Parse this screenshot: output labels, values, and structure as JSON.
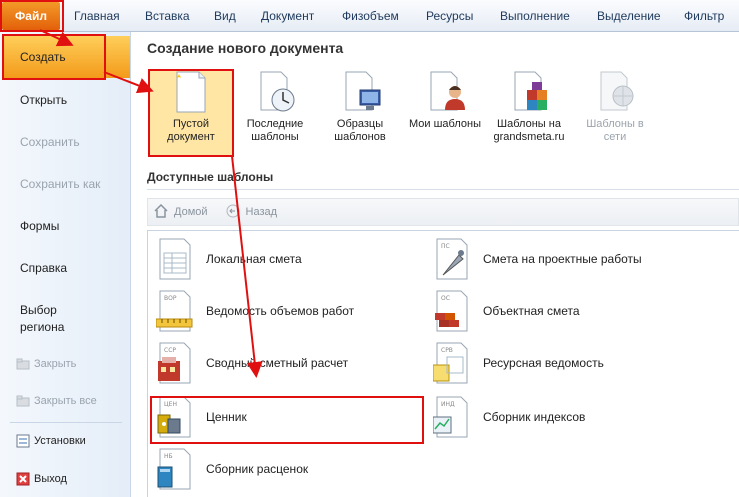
{
  "menubar": {
    "file": "Файл",
    "items": [
      "Главная",
      "Вставка",
      "Вид",
      "Документ",
      "Физобъем",
      "Ресурсы",
      "Выполнение",
      "Выделение",
      "Фильтр"
    ]
  },
  "leftpane": {
    "create": "Создать",
    "open": "Открыть",
    "save": "Сохранить",
    "save_as": "Сохранить как",
    "forms": "Формы",
    "help": "Справка",
    "region_line1": "Выбор",
    "region_line2": "региона",
    "close": "Закрыть",
    "close_all": "Закрыть все",
    "settings": "Установки",
    "exit": "Выход"
  },
  "main": {
    "title": "Создание нового документа",
    "templates": [
      {
        "line1": "Пустой",
        "line2": "документ",
        "icon": "blank-document-icon"
      },
      {
        "line1": "Последние",
        "line2": "шаблоны",
        "icon": "recent-templates-icon"
      },
      {
        "line1": "Образцы",
        "line2": "шаблонов",
        "icon": "sample-templates-icon"
      },
      {
        "line1": "Мои шаблоны",
        "line2": "",
        "icon": "my-templates-icon"
      },
      {
        "line1": "Шаблоны на",
        "line2": "grandsmeta.ru",
        "icon": "web-templates-icon"
      },
      {
        "line1": "Шаблоны в",
        "line2": "сети",
        "icon": "network-templates-icon"
      }
    ],
    "available_title": "Доступные шаблоны",
    "nav_home": "Домой",
    "nav_back": "Назад",
    "list": [
      {
        "label": "Локальная смета",
        "code": ""
      },
      {
        "label": "Смета на проектные работы",
        "code": "ПС"
      },
      {
        "label": "Ведомость объемов работ",
        "code": "ВОР"
      },
      {
        "label": "Объектная смета",
        "code": "ОС"
      },
      {
        "label": "Сводный сметный расчет",
        "code": "ССР"
      },
      {
        "label": "Ресурсная ведомость",
        "code": "СРВ"
      },
      {
        "label": "Ценник",
        "code": "ЦЕН"
      },
      {
        "label": "Сборник индексов",
        "code": "ИНД"
      },
      {
        "label": "Сборник расценок",
        "code": "НБ"
      }
    ]
  },
  "colors": {
    "accent": "#f39a1a",
    "highlight": "#e01010",
    "menu_text": "#1e395b"
  }
}
